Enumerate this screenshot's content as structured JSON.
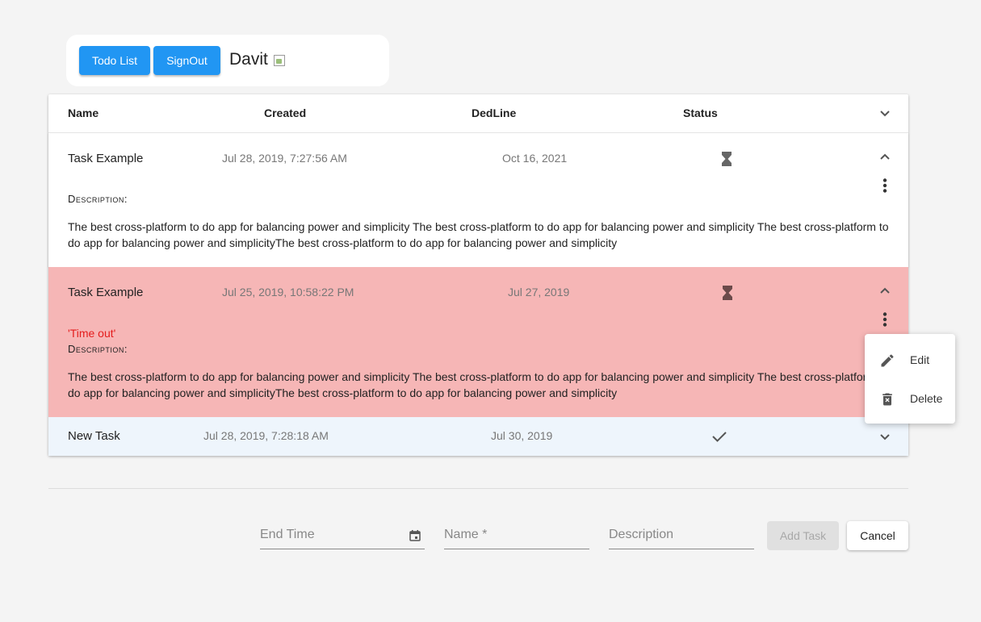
{
  "topbar": {
    "todo_label": "Todo List",
    "signout_label": "SignOut",
    "username": "Davit"
  },
  "table": {
    "headers": [
      "Name",
      "Created",
      "DedLine",
      "Status"
    ],
    "rows": [
      {
        "name": "Task Example",
        "created": "Jul 28, 2019, 7:27:56 AM",
        "deadline": "Oct 16, 2021",
        "status_icon": "hourglass-icon",
        "expanded": true,
        "desc_label": "Description:",
        "description": "The best cross-platform to do app for balancing power and simplicity The best cross-platform to do app for balancing power and simplicity The best cross-platform to do app for balancing power and simplicityThe best cross-platform to do app for balancing power and simplicity"
      },
      {
        "name": "Task Example",
        "created": "Jul 25, 2019, 10:58:22 PM",
        "deadline": "Jul 27, 2019",
        "status_icon": "hourglass-icon",
        "expanded": true,
        "timeout": "'Time out'",
        "desc_label": "Description:",
        "description": "The best cross-platform to do app for balancing power and simplicity The best cross-platform to do app for balancing power and simplicity The best cross-platform to do app for balancing power and simplicityThe best cross-platform to do app for balancing power and simplicity"
      },
      {
        "name": "New Task",
        "created": "Jul 28, 2019, 7:28:18 AM",
        "deadline": "Jul 30, 2019",
        "status_icon": "check-icon",
        "expanded": false
      }
    ]
  },
  "menu": {
    "edit": "Edit",
    "delete": "Delete"
  },
  "form": {
    "end_time_placeholder": "End Time",
    "name_placeholder": "Name *",
    "description_placeholder": "Description",
    "add_label": "Add Task",
    "cancel_label": "Cancel"
  },
  "colors": {
    "primary": "#2196f3",
    "overdue_row": "#f6b6b6",
    "done_row": "#eef5fc",
    "timeout_text": "#e41c1c"
  }
}
